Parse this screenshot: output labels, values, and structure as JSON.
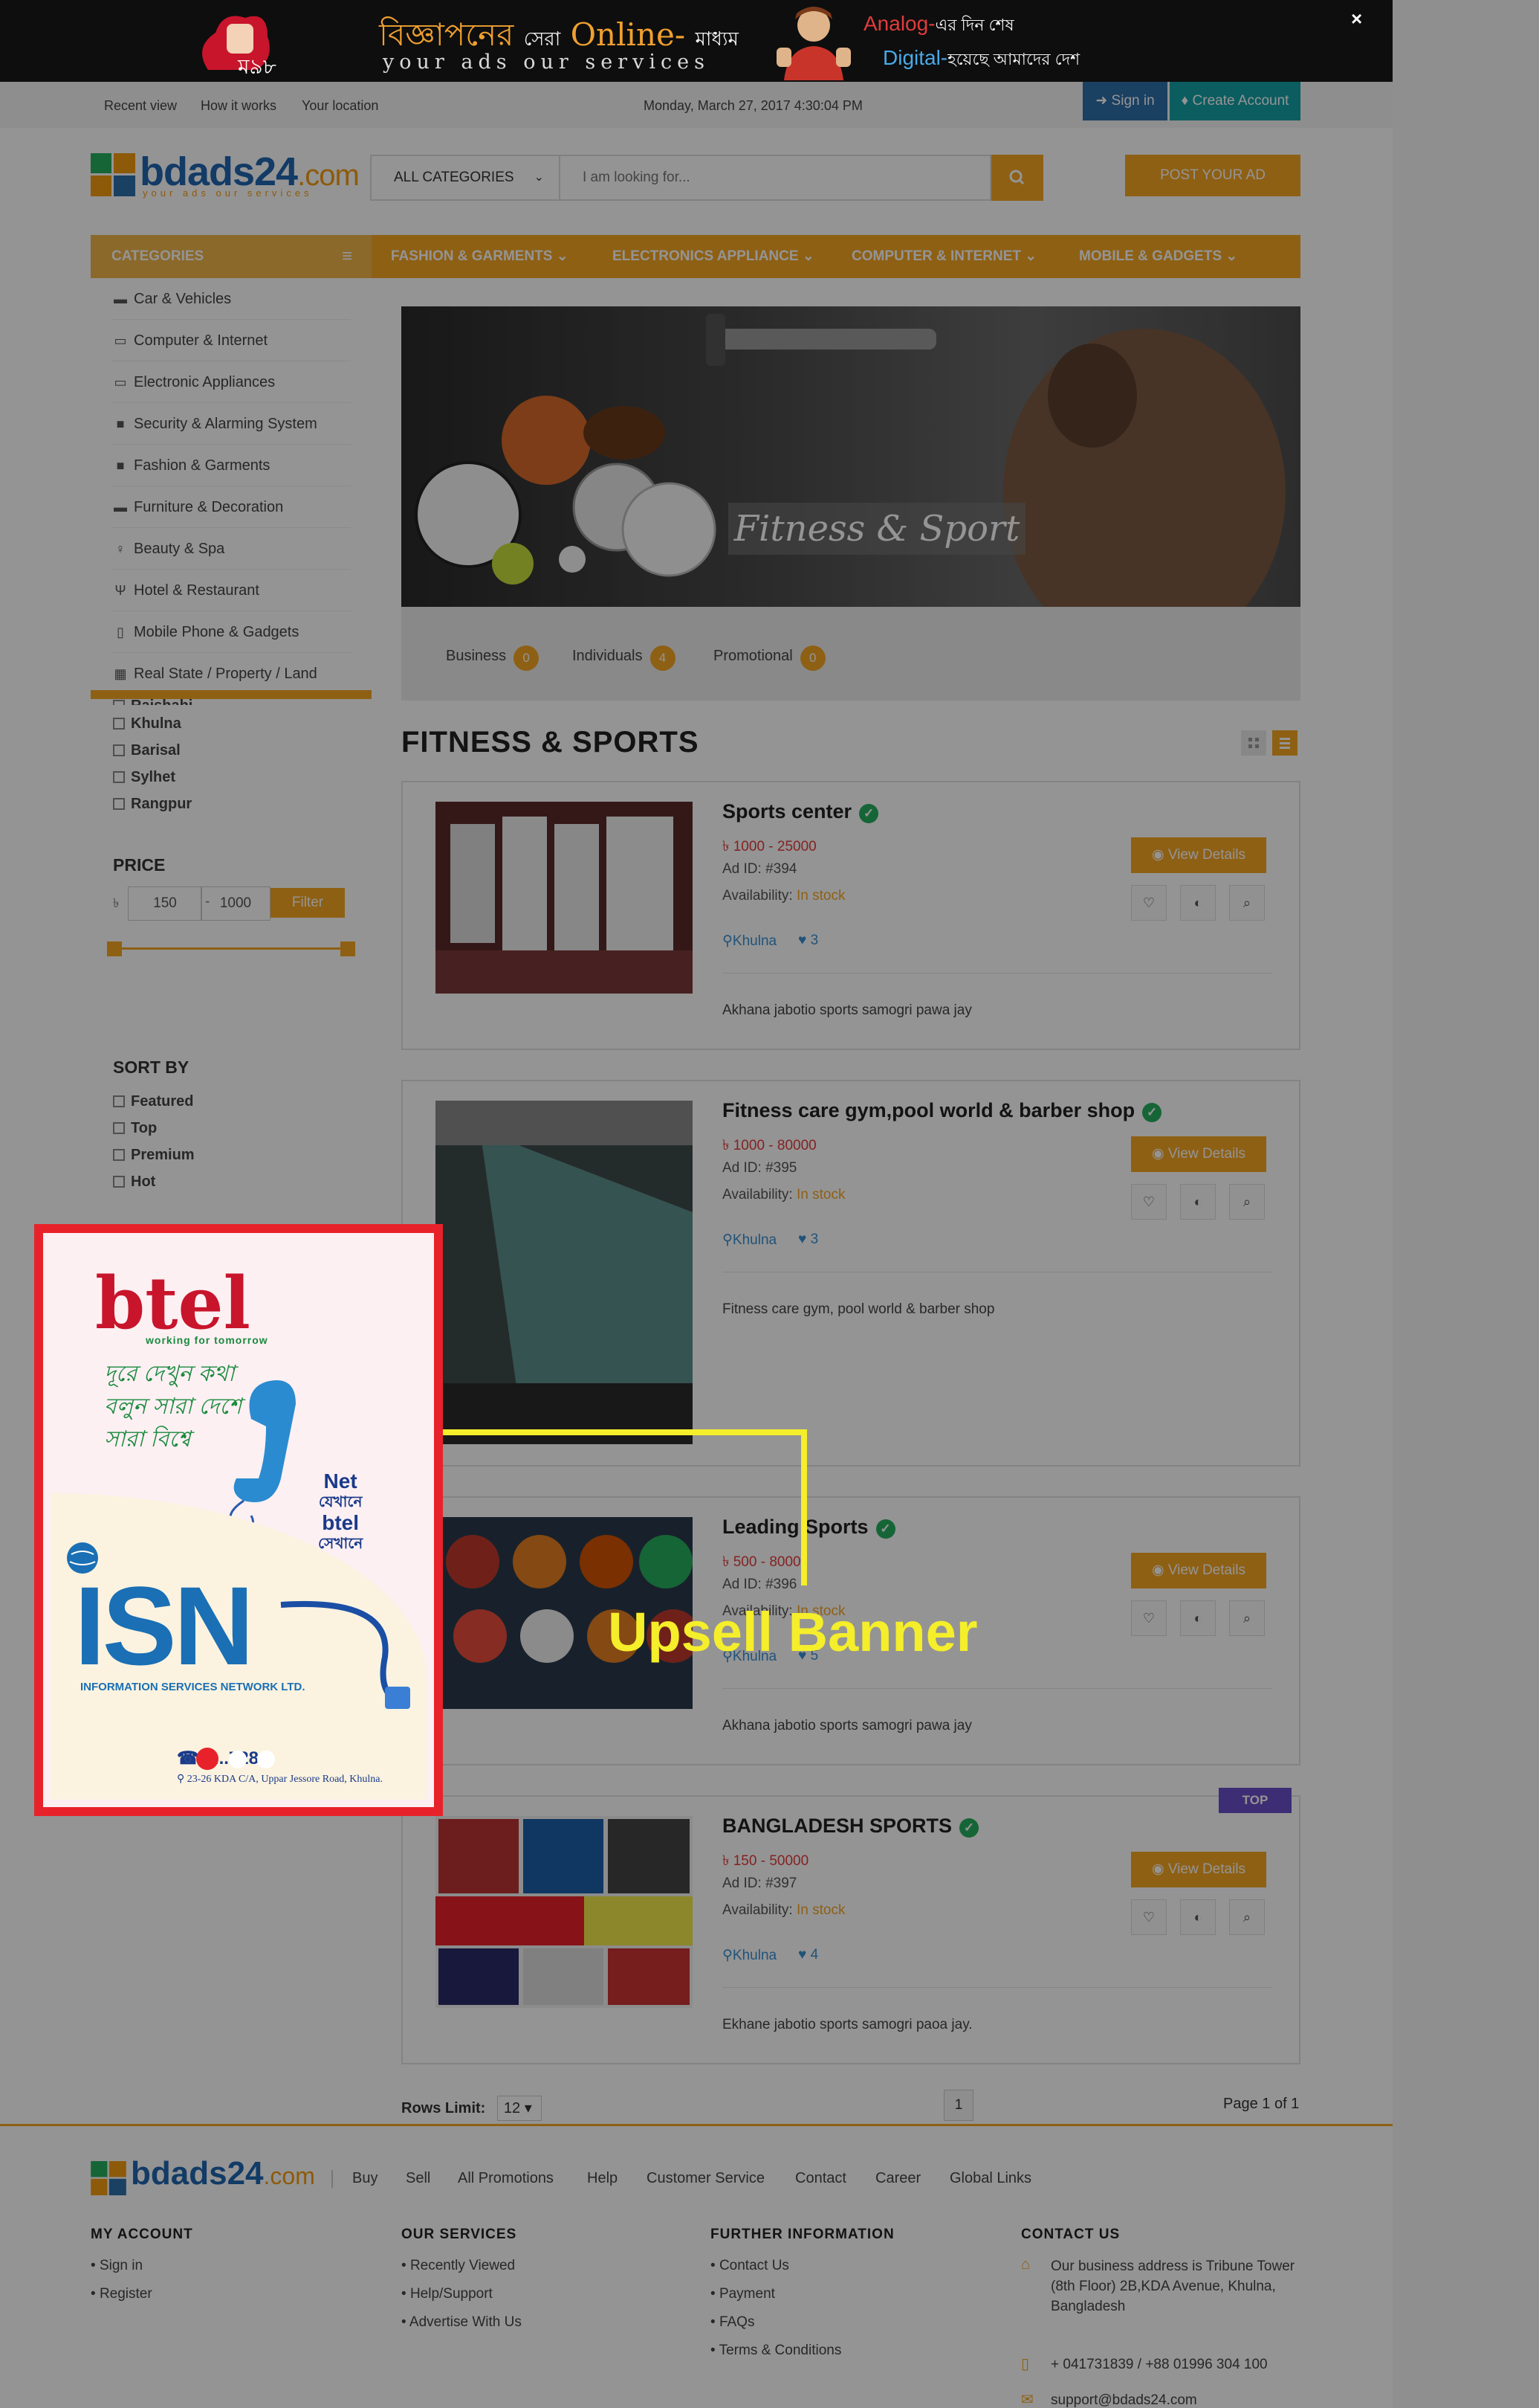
{
  "top_banner": {
    "head_bn": "বিজ্ঞাপনের",
    "head_small": "সেরা",
    "head_online": "Online-",
    "head_end": "মাধ্যম",
    "tagline": "your ads our services",
    "analog": "Analog-",
    "analog_rest": "এর দিন শেষ",
    "digital": "Digital-",
    "digital_rest": "হয়েছে আমাদের দেশ",
    "close": "×"
  },
  "utility": {
    "recent_view": "Recent view",
    "how_it_works": "How it works",
    "your_location": "Your location",
    "date": "Monday, March 27, 2017 4:30:04 PM",
    "sign_in": "Sign in",
    "create_account": "Create Account"
  },
  "header": {
    "logo_word": "bdads24",
    "logo_domain": ".com",
    "logo_tag": "your ads our services",
    "category_select": "ALL CATEGORIES",
    "search_placeholder": "I am looking for...",
    "post_ad": "POST YOUR AD"
  },
  "nav": {
    "categories": "CATEGORIES",
    "items": [
      {
        "label": "FASHION & GARMENTS ⌄"
      },
      {
        "label": "ELECTRONICS APPLIANCE ⌄"
      },
      {
        "label": "COMPUTER & INTERNET ⌄"
      },
      {
        "label": "MOBILE & GADGETS ⌄"
      }
    ]
  },
  "sidebar": {
    "items": [
      {
        "label": "Car & Vehicles",
        "icon": "car-icon"
      },
      {
        "label": "Computer & Internet",
        "icon": "laptop-icon"
      },
      {
        "label": "Electronic Appliances",
        "icon": "monitor-icon"
      },
      {
        "label": "Security & Alarming System",
        "icon": "lock-icon"
      },
      {
        "label": "Fashion & Garments",
        "icon": "briefcase-icon"
      },
      {
        "label": "Furniture & Decoration",
        "icon": "bed-icon"
      },
      {
        "label": "Beauty & Spa",
        "icon": "female-icon"
      },
      {
        "label": "Hotel & Restaurant",
        "icon": "cutlery-icon"
      },
      {
        "label": "Mobile Phone & Gadgets",
        "icon": "mobile-icon"
      },
      {
        "label": "Real State / Property / Land",
        "icon": "building-icon"
      }
    ],
    "cities": [
      "Rajshahi",
      "Khulna",
      "Barisal",
      "Sylhet",
      "Rangpur"
    ],
    "price_title": "PRICE",
    "price_currency": "৳",
    "price_min": "150",
    "price_max": "1000",
    "price_dash": "-",
    "filter": "Filter",
    "sort_title": "SORT BY",
    "sort_options": [
      "Featured",
      "Top",
      "Premium",
      "Hot"
    ]
  },
  "upsell_ad": {
    "brand": "btel",
    "brand_sub": "working for tomorrow",
    "bengali": "দূরে দেখুন কথা বলুন সারা দেশে সারা বিশ্বে",
    "net": "Net",
    "net_bn1": "যেখানে",
    "btel": "btel",
    "net_bn2": "সেখানে",
    "isn": "ISN",
    "isn_sub": "INFORMATION SERVICES NETWORK LTD.",
    "phone": "☎ 9...728",
    "address": "23-26 KDA C/A, Uppar Jessore Road, Khulna."
  },
  "annotation": {
    "label": "Upsell Banner"
  },
  "hero": {
    "caption": "Fitness & Sport"
  },
  "tabs": [
    {
      "label": "Business",
      "count": "0"
    },
    {
      "label": "Individuals",
      "count": "4"
    },
    {
      "label": "Promotional",
      "count": "0"
    }
  ],
  "page_title": "FITNESS & SPORTS",
  "listings": [
    {
      "title": "Sports center",
      "price": "৳ 1000 - 25000",
      "ad_id": "Ad ID: #394",
      "availability_label": "Availability:",
      "availability": "In stock",
      "location": "Khulna",
      "likes": "3",
      "description": "Akhana jabotio sports samogri pawa jay",
      "view": "View Details"
    },
    {
      "title": "Fitness care gym,pool world & barber shop",
      "price": "৳ 1000 - 80000",
      "ad_id": "Ad ID: #395",
      "availability_label": "Availability:",
      "availability": "In stock",
      "location": "Khulna",
      "likes": "3",
      "description": "Fitness care gym, pool world & barber shop",
      "view": "View Details"
    },
    {
      "title": "Leading Sports",
      "price": "৳ 500 - 8000",
      "ad_id": "Ad ID: #396",
      "availability_label": "Availability:",
      "availability": "In stock",
      "location": "Khulna",
      "likes": "5",
      "description": "Akhana jabotio sports samogri pawa jay",
      "view": "View Details"
    },
    {
      "title": "BANGLADESH SPORTS",
      "price": "৳ 150 - 50000",
      "ad_id": "Ad ID: #397",
      "availability_label": "Availability:",
      "availability": "In stock",
      "location": "Khulna",
      "likes": "4",
      "description": "Ekhane jabotio sports samogri paoa jay.",
      "view": "View Details"
    }
  ],
  "top_badge": "TOP",
  "pagination": {
    "rows_limit_label": "Rows Limit:",
    "rows_limit": "12",
    "page": "1",
    "page_of": "Page 1 of 1"
  },
  "footer": {
    "links": [
      "Buy",
      "Sell",
      "All Promotions",
      "Help",
      "Customer Service",
      "Contact",
      "Career",
      "Global Links"
    ],
    "my_account": {
      "title": "MY ACCOUNT",
      "items": [
        "Sign in",
        "Register"
      ]
    },
    "our_services": {
      "title": "OUR SERVICES",
      "items": [
        "Recently Viewed",
        "Help/Support",
        "Advertise With Us"
      ]
    },
    "further_info": {
      "title": "FURTHER INFORMATION",
      "items": [
        "Contact Us",
        "Payment",
        "FAQs",
        "Terms & Conditions"
      ]
    },
    "contact": {
      "title": "CONTACT US",
      "address": "Our business address is Tribune Tower (8th Floor) 2B,KDA Avenue, Khulna, Bangladesh",
      "phone": "+ 041731839 / +88 01996 304 100",
      "email": "support@bdads24.com"
    }
  },
  "colors": {
    "accent": "#f5a623",
    "upsell_border": "#e8222a",
    "annotation": "#f5ee2a",
    "link_blue": "#3a8fd0"
  }
}
